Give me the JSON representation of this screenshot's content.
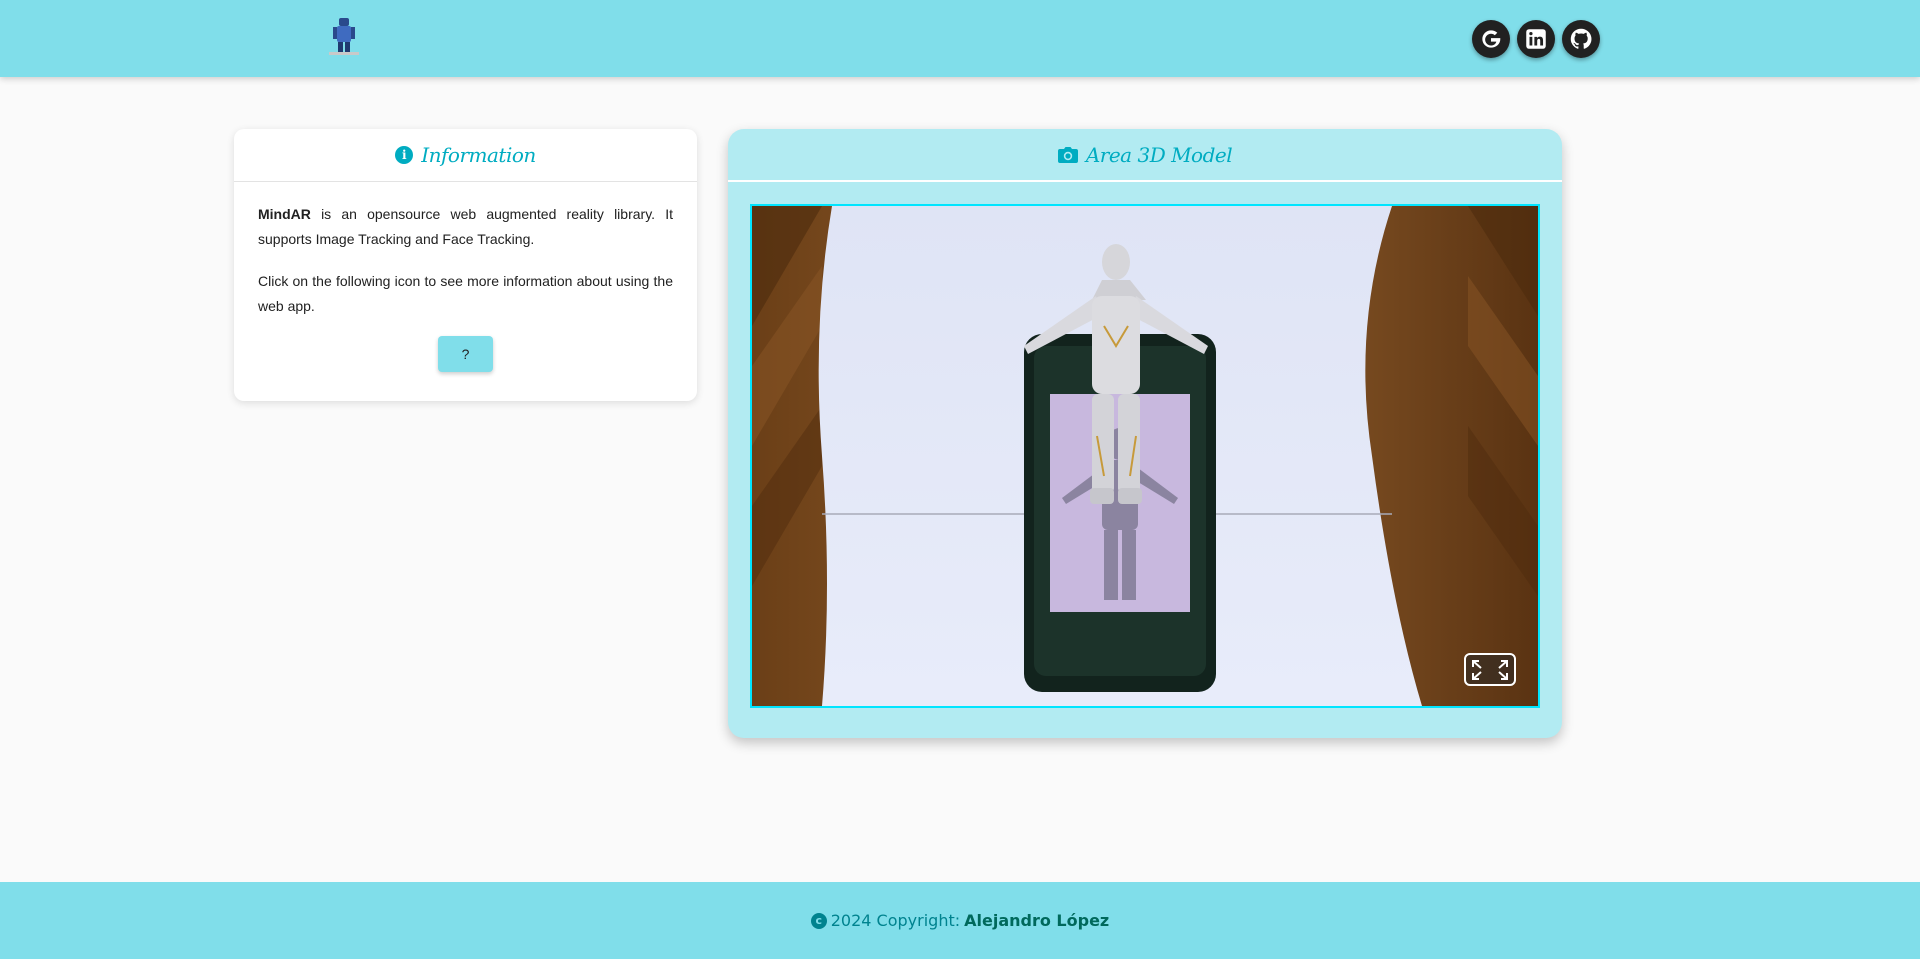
{
  "header": {
    "logo_icon": "robot-figure-logo",
    "social": [
      {
        "name": "google",
        "icon": "google-icon"
      },
      {
        "name": "linkedin",
        "icon": "linkedin-icon"
      },
      {
        "name": "github",
        "icon": "github-icon"
      }
    ]
  },
  "info": {
    "title": "Information",
    "icon": "info-circle-icon",
    "brand": "MindAR",
    "paragraph1_rest": " is an opensource web augmented reality library. It supports Image Tracking and Face Tracking.",
    "paragraph2": "Click on the following icon to see more information about using the web app.",
    "help_label": "?"
  },
  "area": {
    "title": "Area 3D Model",
    "icon": "camera-icon",
    "fullscreen_icon": "expand-icon"
  },
  "footer": {
    "copyright_prefix": "2024 Copyright:",
    "author": "Alejandro López"
  },
  "colors": {
    "header_bg": "#80deea",
    "accent": "#00acc1",
    "area_bg": "#b2ebf2",
    "viewport_border": "#00e5ff"
  }
}
